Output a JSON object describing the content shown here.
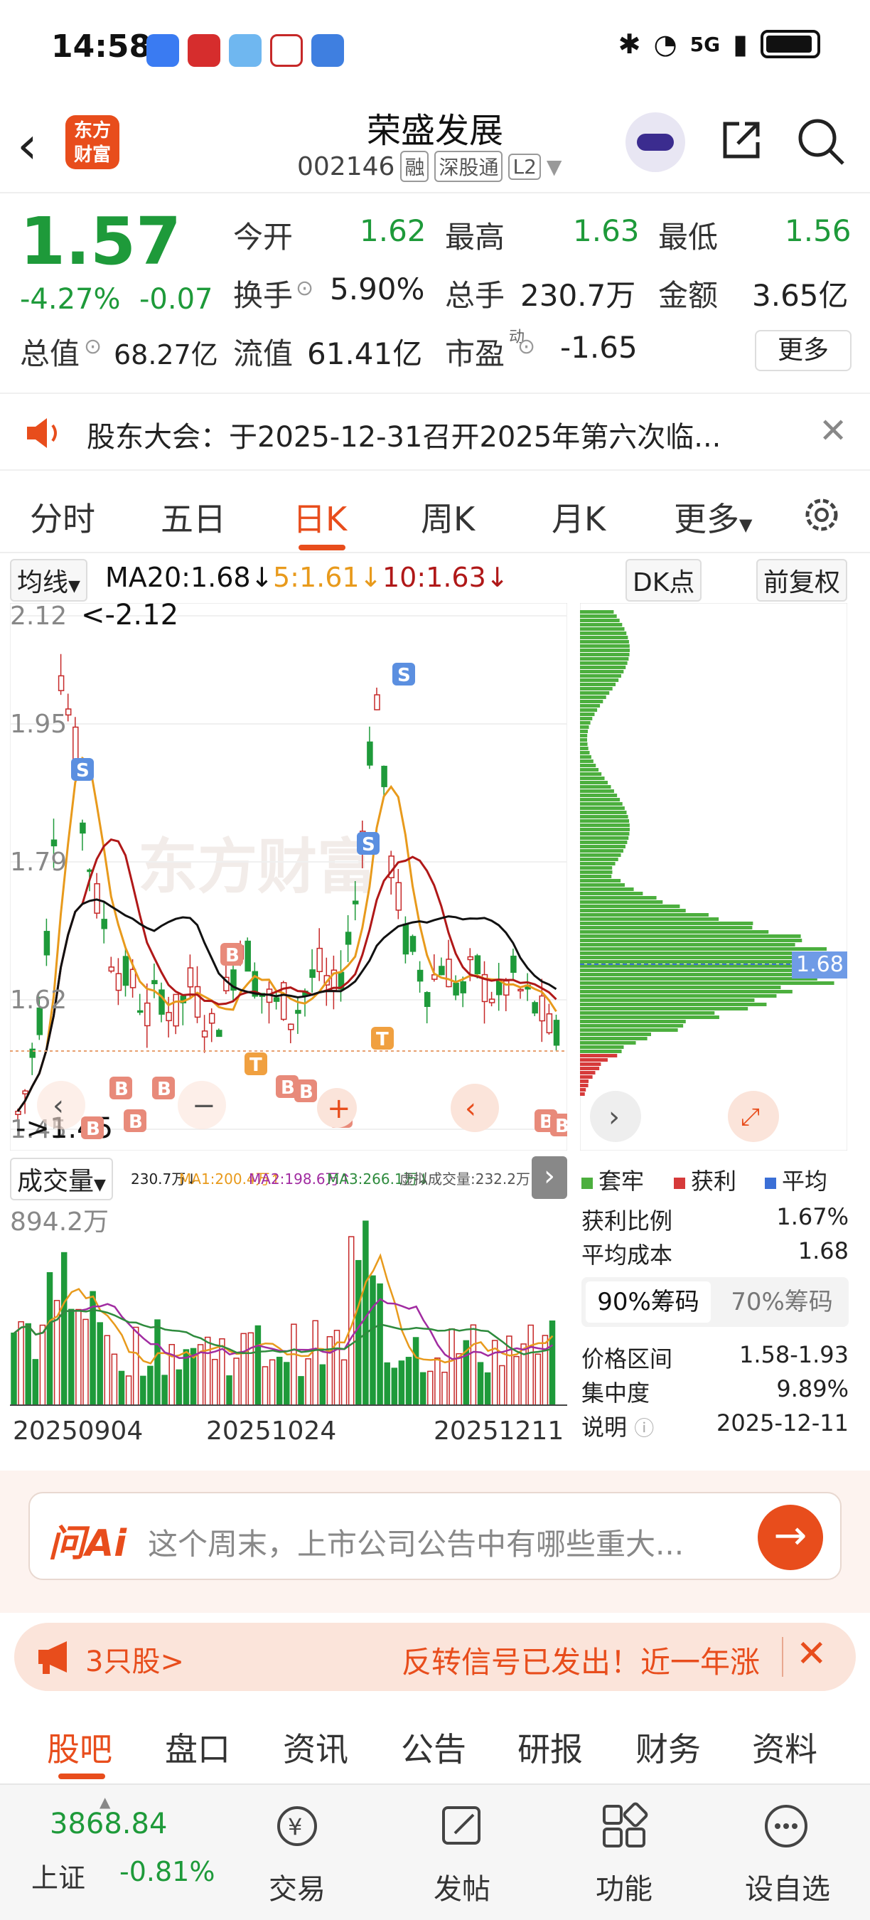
{
  "status_bar": {
    "time": "14:58",
    "signal_text": "5G",
    "app_icons": [
      "honor-icon",
      "broker-icon",
      "weather-icon",
      "app-icon",
      "notes-icon"
    ]
  },
  "header": {
    "logo_text_1": "东方",
    "logo_text_2": "财富",
    "stock_name": "荣盛发展",
    "stock_code": "002146",
    "tags": [
      "融",
      "深股通",
      "L2"
    ]
  },
  "quote": {
    "price": "1.57",
    "change_pct": "-4.27%",
    "change_val": "-0.07",
    "labels": {
      "open": "今开",
      "high": "最高",
      "low": "最低",
      "turnover": "换手",
      "volume": "总手",
      "amount": "金额",
      "mcap": "总值",
      "float_cap": "流值",
      "pe": "市盈"
    },
    "values": {
      "open": "1.62",
      "high": "1.63",
      "low": "1.56",
      "turnover": "5.90%",
      "volume": "230.7万",
      "amount": "3.65亿",
      "mcap": "68.27亿",
      "float_cap": "61.41亿",
      "pe": "-1.65"
    },
    "pe_superscript": "动",
    "more_label": "更多"
  },
  "notice": {
    "text": "股东大会：于2025-12-31召开2025年第六次临..."
  },
  "tabs": [
    "分时",
    "五日",
    "日K",
    "周K",
    "月K",
    "更多"
  ],
  "active_tab": "日K",
  "indicators": {
    "type_chip": "均线",
    "ma20": "MA20:1.68↓",
    "ma5": "5:1.61↓",
    "ma10": "10:1.63↓",
    "dk_chip": "DK点",
    "adjust_chip": "前复权"
  },
  "colors": {
    "accent": "#e84d1c",
    "down": "#1e9a3a",
    "up": "#c62828",
    "ma5": "#e89a1c",
    "ma10": "#b01818",
    "ma20": "#111111",
    "chip_green": "#4caf3e",
    "chip_red": "#d63a3a",
    "chip_blue": "#3b6fd6"
  },
  "kchart": {
    "y_labels": [
      "2.12",
      "1.95",
      "1.79",
      "1.62",
      "1.45"
    ],
    "max_label": "<-2.12",
    "min_label": "->1.45",
    "watermark": "东方财富",
    "signal_S": "S",
    "signal_B": "B",
    "signal_T": "T"
  },
  "chip_panel": {
    "avg_label": "1.68",
    "legend": [
      "套牢",
      "获利",
      "平均"
    ],
    "rows": [
      {
        "label": "获利比例",
        "value": "1.67%"
      },
      {
        "label": "平均成本",
        "value": "1.68"
      }
    ],
    "tabs": [
      "90%筹码",
      "70%筹码"
    ],
    "rows2": [
      {
        "label": "价格区间",
        "value": "1.58-1.93"
      },
      {
        "label": "集中度",
        "value": "9.89%"
      },
      {
        "label": "说明",
        "value": "2025-12-11"
      }
    ]
  },
  "volume": {
    "chip": "成交量",
    "vol": "230.7万↓",
    "ma1": "MA1:200.4万↑",
    "ma2": "MA2:198.6万↑",
    "ma3": "MA3:266.1万↓",
    "virtual": "虚拟成交量:232.2万",
    "max_label": "894.2万",
    "dates": [
      "20250904",
      "20251024",
      "20251211"
    ]
  },
  "ai": {
    "logo": "问Ai",
    "placeholder": "这个周末，上市公司公告中有哪些重大..."
  },
  "promo": {
    "left": "3只股>",
    "right": "反转信号已发出！近一年涨"
  },
  "subtabs": [
    "股吧",
    "盘口",
    "资讯",
    "公告",
    "研报",
    "财务",
    "资料"
  ],
  "bottom_nav": {
    "index_value": "3868.84",
    "index_name": "上证",
    "index_change": "-0.81%",
    "items": [
      "交易",
      "发帖",
      "功能",
      "设自选"
    ]
  }
}
